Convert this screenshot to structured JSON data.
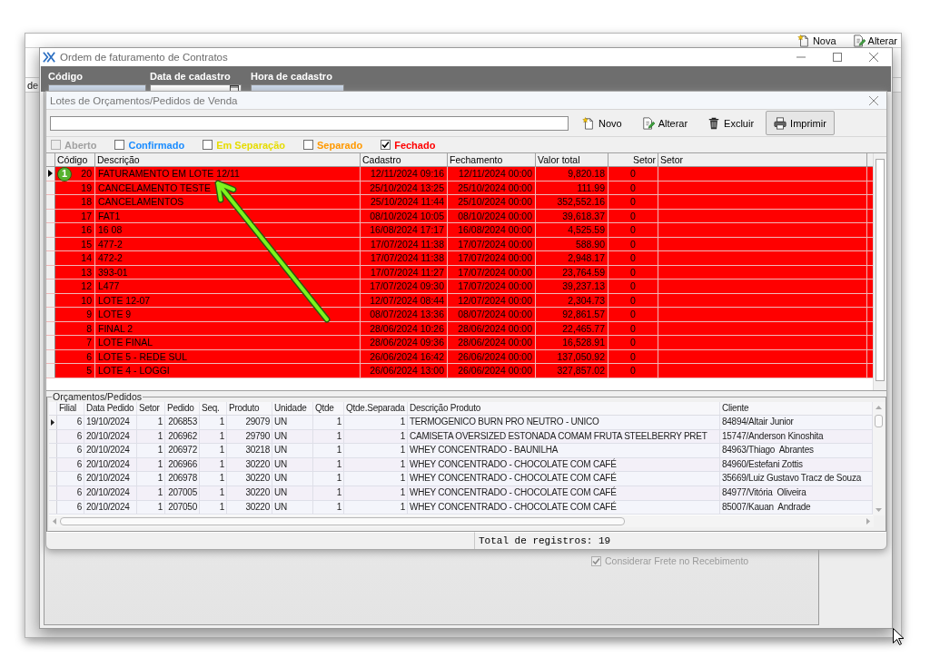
{
  "background_window": {
    "toolbar_buttons": [
      {
        "label": "Nova",
        "kind": "new"
      },
      {
        "label": "Alterar",
        "kind": "edit"
      }
    ],
    "side_label": "de"
  },
  "main_window": {
    "title": "Ordem de faturamento de Contratos",
    "header_fields": [
      {
        "label": "Código",
        "kind": "text",
        "disabled": true
      },
      {
        "label": "Data de cadastro",
        "kind": "date",
        "disabled": false
      },
      {
        "label": "Hora de cadastro",
        "kind": "text",
        "disabled": true
      }
    ],
    "option": {
      "label": "Considerar Frete no Recebimento",
      "checked": true,
      "disabled": true
    }
  },
  "dialog": {
    "title": "Lotes de Orçamentos/Pedidos de Venda",
    "toolbar_buttons": [
      {
        "label": "Novo",
        "kind": "new",
        "focused": false
      },
      {
        "label": "Alterar",
        "kind": "edit",
        "focused": false
      },
      {
        "label": "Excluir",
        "kind": "delete",
        "focused": false
      },
      {
        "label": "Imprimir",
        "kind": "print",
        "focused": true
      }
    ],
    "filters": [
      {
        "label": "Aberto",
        "checked": false,
        "disabled": true,
        "color": "#a0a0a0"
      },
      {
        "label": "Confirmado",
        "checked": false,
        "disabled": false,
        "color": "#1a8cff"
      },
      {
        "label": "Em Separação",
        "checked": false,
        "disabled": false,
        "color": "#e6dc00"
      },
      {
        "label": "Separado",
        "checked": false,
        "disabled": false,
        "color": "#ff9900"
      },
      {
        "label": "Fechado",
        "checked": true,
        "disabled": false,
        "color": "#ff0000"
      }
    ],
    "lots_table": {
      "columns": [
        "Código",
        "Descrição",
        "Cadastro",
        "Fechamento",
        "Valor total",
        "Setor",
        "Setor"
      ],
      "rows": [
        {
          "selected": true,
          "color": "#ff0000",
          "cells": [
            "20",
            "FATURAMENTO EM LOTE 12/11",
            "12/11/2024 09:16",
            "12/11/2024 00:00",
            "9,820.18",
            "0"
          ]
        },
        {
          "selected": false,
          "color": "#ff0000",
          "cells": [
            "19",
            "CANCELAMENTO TESTE",
            "25/10/2024 13:25",
            "25/10/2024 00:00",
            "111.99",
            "0"
          ]
        },
        {
          "selected": false,
          "color": "#ff0000",
          "cells": [
            "18",
            "CANCELAMENTOS",
            "25/10/2024 11:44",
            "25/10/2024 00:00",
            "352,552.16",
            "0"
          ]
        },
        {
          "selected": false,
          "color": "#ff0000",
          "cells": [
            "17",
            "FAT1",
            "08/10/2024 10:05",
            "08/10/2024 00:00",
            "39,618.37",
            "0"
          ]
        },
        {
          "selected": false,
          "color": "#ff0000",
          "cells": [
            "16",
            "16 08",
            "16/08/2024 17:17",
            "16/08/2024 00:00",
            "4,525.59",
            "0"
          ]
        },
        {
          "selected": false,
          "color": "#ff0000",
          "cells": [
            "15",
            "477-2",
            "17/07/2024 11:38",
            "17/07/2024 00:00",
            "588.90",
            "0"
          ]
        },
        {
          "selected": false,
          "color": "#ff0000",
          "cells": [
            "14",
            "472-2",
            "17/07/2024 11:38",
            "17/07/2024 00:00",
            "2,948.17",
            "0"
          ]
        },
        {
          "selected": false,
          "color": "#ff0000",
          "cells": [
            "13",
            "393-01",
            "17/07/2024 11:27",
            "17/07/2024 00:00",
            "23,764.59",
            "0"
          ]
        },
        {
          "selected": false,
          "color": "#ff0000",
          "cells": [
            "12",
            "L477",
            "17/07/2024 09:30",
            "17/07/2024 00:00",
            "39,237.13",
            "0"
          ]
        },
        {
          "selected": false,
          "color": "#ff0000",
          "cells": [
            "10",
            "LOTE 12-07",
            "12/07/2024 08:44",
            "12/07/2024 00:00",
            "2,304.73",
            "0"
          ]
        },
        {
          "selected": false,
          "color": "#ff0000",
          "cells": [
            "9",
            "LOTE 9",
            "08/07/2024 13:36",
            "08/07/2024 00:00",
            "92,861.57",
            "0"
          ]
        },
        {
          "selected": false,
          "color": "#ff0000",
          "cells": [
            "8",
            "FINAL 2",
            "28/06/2024 10:26",
            "28/06/2024 00:00",
            "22,465.77",
            "0"
          ]
        },
        {
          "selected": false,
          "color": "#ff0000",
          "cells": [
            "7",
            "LOTE FINAL",
            "28/06/2024 09:36",
            "28/06/2024 00:00",
            "16,528.91",
            "0"
          ]
        },
        {
          "selected": false,
          "color": "#ff0000",
          "cells": [
            "6",
            "LOTE 5 - REDE SUL",
            "26/06/2024 16:42",
            "26/06/2024 00:00",
            "137,050.92",
            "0"
          ]
        },
        {
          "selected": false,
          "color": "#ff0000",
          "cells": [
            "5",
            "LOTE 4 - LOGGI",
            "26/06/2024 13:00",
            "26/06/2024 00:00",
            "327,857.02",
            "0"
          ]
        }
      ]
    },
    "items_group": {
      "title": "Orçamentos/Pedidos",
      "table": {
        "columns": [
          "Filial",
          "Data Pedido",
          "Setor",
          "Pedido",
          "Seq.",
          "Produto",
          "Unidade",
          "Qtde",
          "Qtde.Separada",
          "Descrição Produto",
          "Cliente"
        ],
        "rows": [
          {
            "selected": true,
            "cells": [
              "6",
              "19/10/2024",
              "1",
              "206853",
              "1",
              "29079",
              "UN",
              "1",
              "1",
              "TERMOGENICO BURN PRO NEUTRO - UNICO",
              "84894/Altair Junior"
            ]
          },
          {
            "selected": false,
            "cells": [
              "6",
              "20/10/2024",
              "1",
              "206962",
              "1",
              "29790",
              "UN",
              "1",
              "1",
              "CAMISETA OVERSIZED ESTONADA COMAM FRUTA STEELBERRY PRET",
              "15747/Anderson Kinoshita"
            ]
          },
          {
            "selected": false,
            "cells": [
              "6",
              "20/10/2024",
              "1",
              "206972",
              "1",
              "30218",
              "UN",
              "1",
              "1",
              "WHEY CONCENTRADO - BAUNILHA",
              "84963/Thiago  Abrantes"
            ]
          },
          {
            "selected": false,
            "cells": [
              "6",
              "20/10/2024",
              "1",
              "206966",
              "1",
              "30220",
              "UN",
              "1",
              "1",
              "WHEY CONCENTRADO - CHOCOLATE COM CAFÉ",
              "84960/Estefani Zottis"
            ]
          },
          {
            "selected": false,
            "cells": [
              "6",
              "20/10/2024",
              "1",
              "206978",
              "1",
              "30220",
              "UN",
              "1",
              "1",
              "WHEY CONCENTRADO - CHOCOLATE COM CAFÉ",
              "35669/Luiz Gustavo Tracz de Souza"
            ]
          },
          {
            "selected": false,
            "cells": [
              "6",
              "20/10/2024",
              "1",
              "207005",
              "1",
              "30220",
              "UN",
              "1",
              "1",
              "WHEY CONCENTRADO - CHOCOLATE COM CAFÉ",
              "84977/Vitória  Oliveira"
            ]
          },
          {
            "selected": false,
            "cells": [
              "6",
              "20/10/2024",
              "1",
              "207050",
              "1",
              "30220",
              "UN",
              "1",
              "1",
              "WHEY CONCENTRADO - CHOCOLATE COM CAFÉ",
              "85007/Kauan  Andrade"
            ]
          }
        ]
      }
    },
    "status_bar": {
      "total": "Total de registros: 19"
    }
  },
  "annotation": {
    "badge": "1"
  }
}
